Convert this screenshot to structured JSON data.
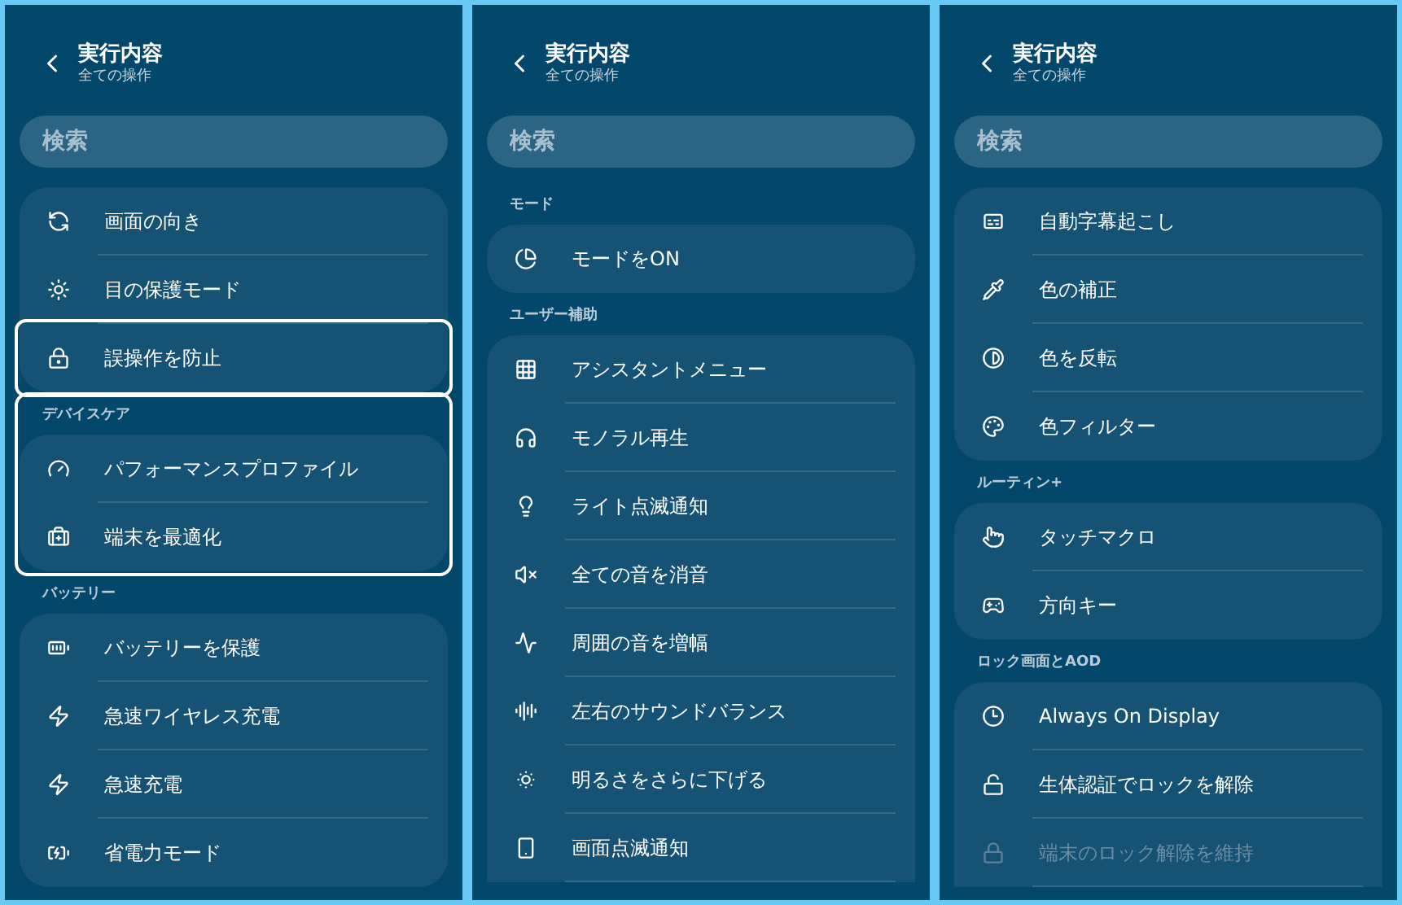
{
  "panels": [
    {
      "header": {
        "title": "実行内容",
        "subtitle": "全ての操作"
      },
      "search": {
        "placeholder": "検索"
      },
      "sections": [
        {
          "highlighted": false,
          "continues": false,
          "items": [
            {
              "label": "画面の向き",
              "highlighted": false,
              "disabled": false
            },
            {
              "label": "目の保護モード",
              "highlighted": false,
              "disabled": false
            },
            {
              "label": "誤操作を防止",
              "highlighted": true,
              "disabled": false
            }
          ]
        },
        {
          "title": "デバイスケア",
          "highlighted": true,
          "continues": false,
          "items": [
            {
              "label": "パフォーマンスプロファイル",
              "highlighted": false,
              "disabled": false
            },
            {
              "label": "端末を最適化",
              "highlighted": false,
              "disabled": false
            }
          ]
        },
        {
          "title": "バッテリー",
          "highlighted": false,
          "continues": false,
          "items": [
            {
              "label": "バッテリーを保護",
              "highlighted": false,
              "disabled": false
            },
            {
              "label": "急速ワイヤレス充電",
              "highlighted": false,
              "disabled": false
            },
            {
              "label": "急速充電",
              "highlighted": false,
              "disabled": false
            },
            {
              "label": "省電力モード",
              "highlighted": false,
              "disabled": false
            }
          ]
        }
      ]
    },
    {
      "header": {
        "title": "実行内容",
        "subtitle": "全ての操作"
      },
      "search": {
        "placeholder": "検索"
      },
      "sections": [
        {
          "title": "モード",
          "highlighted": false,
          "continues": false,
          "items": [
            {
              "label": "モードをON",
              "highlighted": false,
              "disabled": false
            }
          ]
        },
        {
          "title": "ユーザー補助",
          "highlighted": false,
          "continues": true,
          "items": [
            {
              "label": "アシスタントメニュー",
              "highlighted": false,
              "disabled": false
            },
            {
              "label": "モノラル再生",
              "highlighted": false,
              "disabled": false
            },
            {
              "label": "ライト点滅通知",
              "highlighted": false,
              "disabled": false
            },
            {
              "label": "全ての音を消音",
              "highlighted": false,
              "disabled": false
            },
            {
              "label": "周囲の音を増幅",
              "highlighted": false,
              "disabled": false
            },
            {
              "label": "左右のサウンドバランス",
              "highlighted": false,
              "disabled": false
            },
            {
              "label": "明るさをさらに下げる",
              "highlighted": false,
              "disabled": false
            },
            {
              "label": "画面点滅通知",
              "highlighted": false,
              "disabled": false
            }
          ]
        }
      ]
    },
    {
      "header": {
        "title": "実行内容",
        "subtitle": "全ての操作"
      },
      "search": {
        "placeholder": "検索"
      },
      "sections": [
        {
          "highlighted": false,
          "continues": false,
          "items": [
            {
              "label": "自動字幕起こし",
              "highlighted": false,
              "disabled": false
            },
            {
              "label": "色の補正",
              "highlighted": false,
              "disabled": false
            },
            {
              "label": "色を反転",
              "highlighted": false,
              "disabled": false
            },
            {
              "label": "色フィルター",
              "highlighted": false,
              "disabled": false
            }
          ]
        },
        {
          "title": "ルーティン+",
          "highlighted": false,
          "continues": false,
          "items": [
            {
              "label": "タッチマクロ",
              "highlighted": false,
              "disabled": false
            },
            {
              "label": "方向キー",
              "highlighted": false,
              "disabled": false
            }
          ]
        },
        {
          "title": "ロック画面とAOD",
          "highlighted": false,
          "continues": true,
          "items": [
            {
              "label": "Always On Display",
              "highlighted": false,
              "disabled": false
            },
            {
              "label": "生体認証でロックを解除",
              "highlighted": false,
              "disabled": false
            },
            {
              "label": "端末のロック解除を維持",
              "highlighted": false,
              "disabled": true
            }
          ]
        }
      ]
    }
  ]
}
